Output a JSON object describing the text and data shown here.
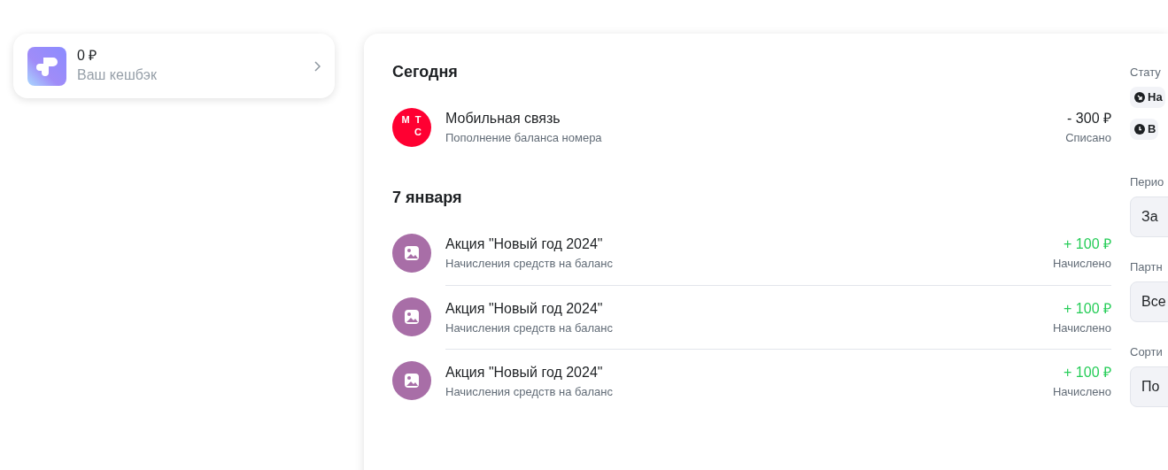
{
  "cashback": {
    "amount": "0 ₽",
    "label": "Ваш кешбэк"
  },
  "groups": [
    {
      "title": "Сегодня",
      "items": [
        {
          "kind": "operator",
          "logo": [
            "М",
            "Т",
            "С"
          ],
          "name": "Мобильная связь",
          "description": "Пополнение баланса номера",
          "amount": "- 300 ₽",
          "credited": false,
          "status": "Списано"
        }
      ]
    },
    {
      "title": "7 января",
      "items": [
        {
          "kind": "promo",
          "name": "Акция \"Новый год 2024\"",
          "description": "Начисления средств на баланс",
          "amount": "+ 100 ₽",
          "credited": true,
          "status": "Начислено"
        },
        {
          "kind": "promo",
          "name": "Акция \"Новый год 2024\"",
          "description": "Начисления средств на баланс",
          "amount": "+ 100 ₽",
          "credited": true,
          "status": "Начислено"
        },
        {
          "kind": "promo",
          "name": "Акция \"Новый год 2024\"",
          "description": "Начисления средств на баланс",
          "amount": "+ 100 ₽",
          "credited": true,
          "status": "Начислено"
        }
      ]
    }
  ],
  "filters": {
    "status_label": "Стату",
    "status_chips": [
      {
        "label": "На",
        "kind": "credit"
      },
      {
        "label": "В",
        "kind": "pending"
      }
    ],
    "selects": [
      {
        "label": "Перио",
        "value": "За"
      },
      {
        "label": "Партн",
        "value": "Все"
      },
      {
        "label": "Сорти",
        "value": "По"
      }
    ]
  }
}
